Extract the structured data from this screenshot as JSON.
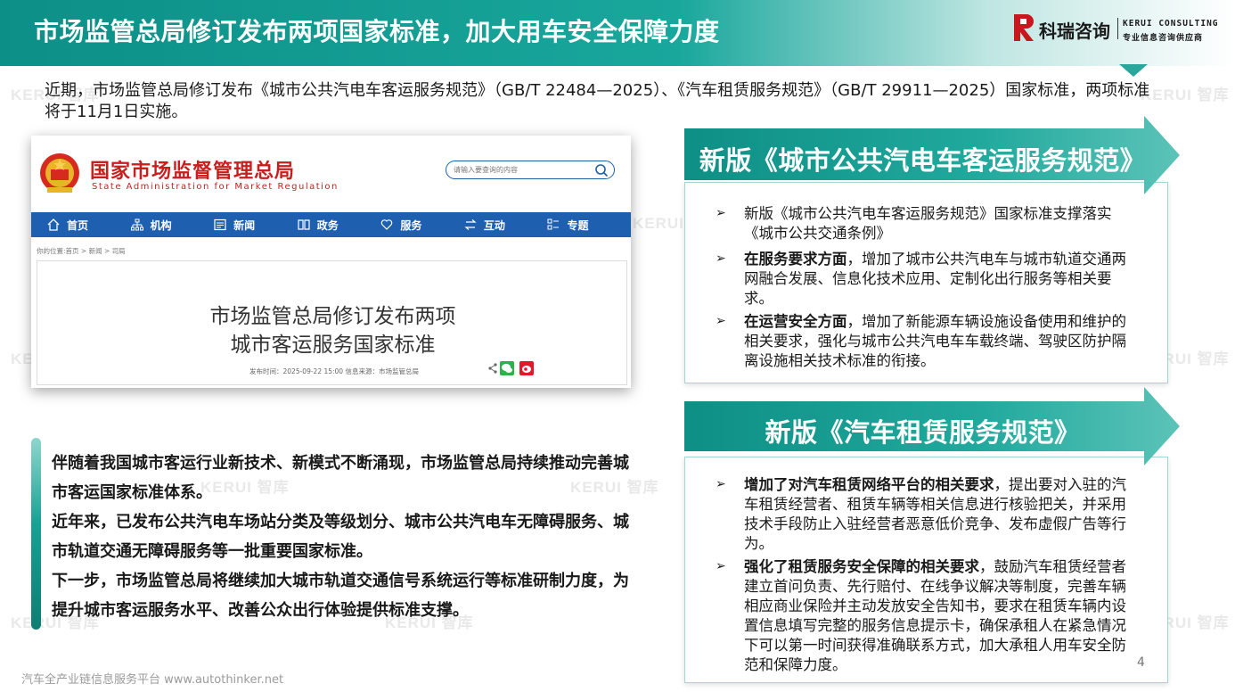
{
  "header": {
    "title": "市场监管总局修订发布两项国家标准，加大用车安全保障力度",
    "brand_cn": "科瑞咨询",
    "brand_en": "KERUI CONSULTING",
    "brand_tagline": "专业信息咨询供应商"
  },
  "watermark": {
    "text": "KERUI 智库"
  },
  "intro": "近期，市场监管总局修订发布《城市公共汽电车客运服务规范》（GB/T 22484—2025）、《汽车租赁服务规范》（GB/T 29911—2025）国家标准，两项标准将于11月1日实施。",
  "screenshot": {
    "site_name": "国家市场监督管理总局",
    "site_name_en": "State Administration for Market Regulation",
    "search_placeholder": "请输入要查询的内容",
    "nav": [
      {
        "label": "首页",
        "icon": "home-icon"
      },
      {
        "label": "机构",
        "icon": "org-icon"
      },
      {
        "label": "新闻",
        "icon": "news-icon"
      },
      {
        "label": "政务",
        "icon": "gov-icon"
      },
      {
        "label": "服务",
        "icon": "heart-icon"
      },
      {
        "label": "互动",
        "icon": "exchange-icon"
      },
      {
        "label": "专题",
        "icon": "topic-icon"
      }
    ],
    "breadcrumb": "你的位置:首页 > 新闻 > 司局",
    "article_title_line1": "市场监管总局修订发布两项",
    "article_title_line2": "城市客运服务国家标准",
    "article_meta": "发布时间：2025-09-22 15:00    信息来源：市场监管总局"
  },
  "quote": {
    "p1": "伴随着我国城市客运行业新技术、新模式不断涌现，市场监管总局持续推动完善城市客运国家标准体系。",
    "p2": "近年来，已发布公共汽电车场站分类及等级划分、城市公共汽电车无障碍服务、城市轨道交通无障碍服务等一批重要国家标准。",
    "p3": "下一步，市场监管总局将继续加大城市轨道交通信号系统运行等标准研制力度，为提升城市客运服务水平、改善公众出行体验提供标准支撑。"
  },
  "section1": {
    "title": "新版《城市公共汽电车客运服务规范》",
    "items": [
      {
        "bold": "",
        "text": "新版《城市公共汽电车客运服务规范》国家标准支撑落实《城市公共交通条例》"
      },
      {
        "bold": "在服务要求方面",
        "text": "，增加了城市公共汽电车与城市轨道交通两网融合发展、信息化技术应用、定制化出行服务等相关要求。"
      },
      {
        "bold": "在运营安全方面",
        "text": "，增加了新能源车辆设施设备使用和维护的相关要求，强化与城市公共汽电车车载终端、驾驶区防护隔离设施相关技术标准的衔接。"
      }
    ]
  },
  "section2": {
    "title": "新版《汽车租赁服务规范》",
    "items": [
      {
        "bold": "增加了对汽车租赁网络平台的相关要求",
        "text": "，提出要对入驻的汽车租赁经营者、租赁车辆等相关信息进行核验把关，并采用技术手段防止入驻经营者恶意低价竞争、发布虚假广告等行为。"
      },
      {
        "bold": "强化了租赁服务安全保障的相关要求",
        "text": "，鼓励汽车租赁经营者建立首问负责、先行赔付、在线争议解决等制度，完善车辆相应商业保险并主动发放安全告知书，要求在租赁车辆内设置信息填写完整的服务信息提示卡，确保承租人在紧急情况下可以第一时间获得准确联系方式，加大承租人用车安全防范和保障力度。"
      }
    ]
  },
  "bullet_symbol": "➢",
  "page_number": "4",
  "footer": "汽车全产业链信息服务平台 www.autothinker.net",
  "colors": {
    "teal": "#17a194",
    "dark_teal": "#0c8f87",
    "nav_blue": "#1f5fb0",
    "site_red": "#c81e1e"
  }
}
